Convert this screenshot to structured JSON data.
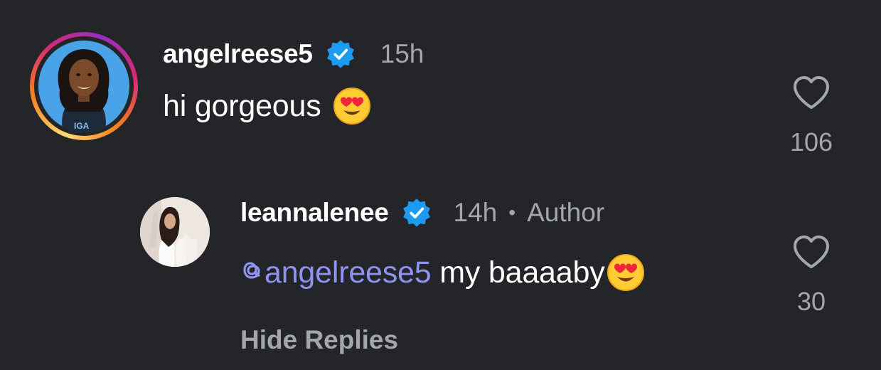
{
  "comments": [
    {
      "username": "angelreese5",
      "time": "15h",
      "text": "hi gorgeous",
      "emoji": "heart-eyes-emoji",
      "likes": "106"
    },
    {
      "username": "leannalenee",
      "time": "14h",
      "separator": "•",
      "author_label": "Author",
      "mention": "angelreese5",
      "text": " my baaaaby",
      "emoji": "heart-eyes-emoji",
      "likes": "30"
    }
  ],
  "hide_replies_label": "Hide Replies",
  "colors": {
    "background": "#232529",
    "mention": "#8f93f0",
    "verified": "#1d9bf0",
    "muted": "#a3a7ad"
  }
}
